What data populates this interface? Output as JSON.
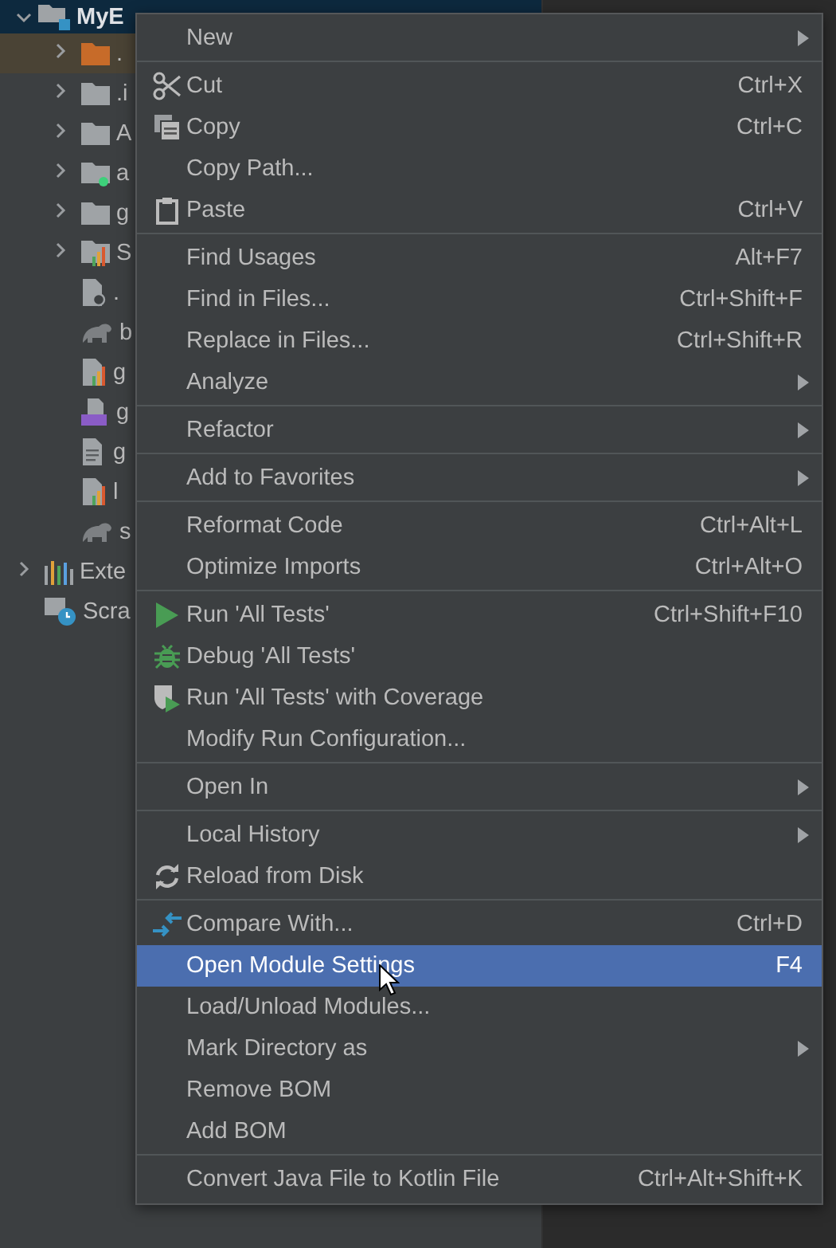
{
  "project_tree": {
    "header": {
      "label": "MyE",
      "expanded": true,
      "selected": true
    },
    "items": [
      {
        "label": ".",
        "kind": "folder-orange",
        "expandable": true,
        "marked": true
      },
      {
        "label": ".i",
        "kind": "folder",
        "expandable": true,
        "marked": false
      },
      {
        "label": "A",
        "kind": "folder",
        "expandable": true,
        "marked": false
      },
      {
        "label": "a",
        "kind": "folder-dot",
        "expandable": true,
        "marked": false
      },
      {
        "label": "g",
        "kind": "folder",
        "expandable": true,
        "marked": false
      },
      {
        "label": "S",
        "kind": "folder-chart",
        "expandable": true,
        "marked": false
      },
      {
        "label": ".",
        "kind": "file-ignore",
        "expandable": false,
        "marked": false
      },
      {
        "label": "b",
        "kind": "gradle",
        "expandable": false,
        "marked": false
      },
      {
        "label": "g",
        "kind": "file-chart",
        "expandable": false,
        "marked": false
      },
      {
        "label": "g",
        "kind": "file-cpp",
        "expandable": false,
        "marked": false
      },
      {
        "label": "g",
        "kind": "file-text",
        "expandable": false,
        "marked": false
      },
      {
        "label": "l",
        "kind": "file-chart",
        "expandable": false,
        "marked": false
      },
      {
        "label": "s",
        "kind": "gradle",
        "expandable": false,
        "marked": false
      }
    ],
    "roots": [
      {
        "label": "Exte",
        "kind": "libraries",
        "expandable": true
      },
      {
        "label": "Scra",
        "kind": "scratches",
        "expandable": false
      }
    ]
  },
  "context_menu": {
    "groups": [
      [
        {
          "label": "New",
          "submenu": true,
          "selected": false
        }
      ],
      [
        {
          "label": "Cut",
          "shortcut": "Ctrl+X",
          "kind": "cut",
          "submenu": false,
          "selected": false
        },
        {
          "label": "Copy",
          "shortcut": "Ctrl+C",
          "kind": "copy",
          "submenu": false,
          "selected": false
        },
        {
          "label": "Copy Path...",
          "submenu": false,
          "selected": false
        },
        {
          "label": "Paste",
          "shortcut": "Ctrl+V",
          "kind": "paste",
          "submenu": false,
          "selected": false
        }
      ],
      [
        {
          "label": "Find Usages",
          "shortcut": "Alt+F7",
          "submenu": false,
          "selected": false
        },
        {
          "label": "Find in Files...",
          "shortcut": "Ctrl+Shift+F",
          "submenu": false,
          "selected": false
        },
        {
          "label": "Replace in Files...",
          "shortcut": "Ctrl+Shift+R",
          "submenu": false,
          "selected": false
        },
        {
          "label": "Analyze",
          "submenu": true,
          "selected": false
        }
      ],
      [
        {
          "label": "Refactor",
          "submenu": true,
          "selected": false
        }
      ],
      [
        {
          "label": "Add to Favorites",
          "submenu": true,
          "selected": false
        }
      ],
      [
        {
          "label": "Reformat Code",
          "shortcut": "Ctrl+Alt+L",
          "submenu": false,
          "selected": false
        },
        {
          "label": "Optimize Imports",
          "shortcut": "Ctrl+Alt+O",
          "submenu": false,
          "selected": false
        }
      ],
      [
        {
          "label": "Run 'All Tests'",
          "shortcut": "Ctrl+Shift+F10",
          "kind": "run",
          "submenu": false,
          "selected": false
        },
        {
          "label": "Debug 'All Tests'",
          "kind": "debug",
          "submenu": false,
          "selected": false
        },
        {
          "label": "Run 'All Tests' with Coverage",
          "kind": "coverage",
          "submenu": false,
          "selected": false
        },
        {
          "label": "Modify Run Configuration...",
          "submenu": false,
          "selected": false
        }
      ],
      [
        {
          "label": "Open In",
          "submenu": true,
          "selected": false
        }
      ],
      [
        {
          "label": "Local History",
          "submenu": true,
          "selected": false
        },
        {
          "label": "Reload from Disk",
          "kind": "reload",
          "submenu": false,
          "selected": false
        }
      ],
      [
        {
          "label": "Compare With...",
          "shortcut": "Ctrl+D",
          "kind": "compare",
          "submenu": false,
          "selected": false
        },
        {
          "label": "Open Module Settings",
          "shortcut": "F4",
          "submenu": false,
          "selected": true
        },
        {
          "label": "Load/Unload Modules...",
          "submenu": false,
          "selected": false
        },
        {
          "label": "Mark Directory as",
          "submenu": true,
          "selected": false
        },
        {
          "label": "Remove BOM",
          "submenu": false,
          "selected": false
        },
        {
          "label": "Add BOM",
          "submenu": false,
          "selected": false
        }
      ],
      [
        {
          "label": "Convert Java File to Kotlin File",
          "shortcut": "Ctrl+Alt+Shift+K",
          "submenu": false,
          "selected": false
        }
      ]
    ]
  }
}
